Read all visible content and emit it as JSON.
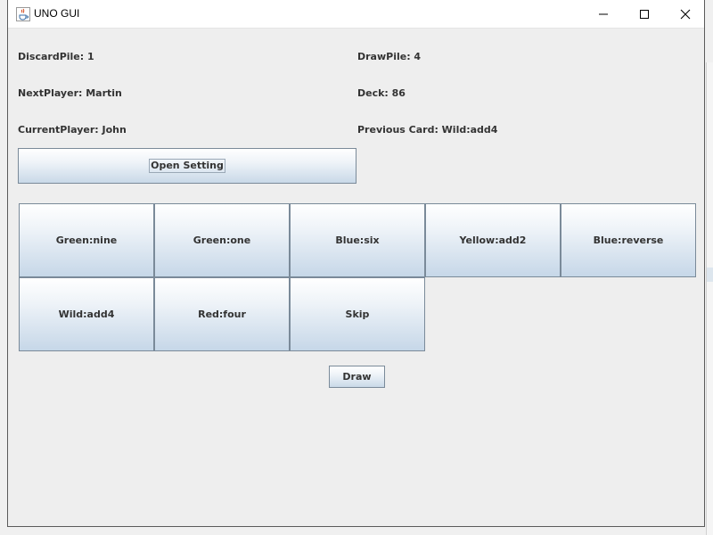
{
  "window": {
    "title": "UNO GUI",
    "icon": "java-cup-icon"
  },
  "info": {
    "discard_pile": "DiscardPile: 1",
    "draw_pile": "DrawPile: 4",
    "next_player": "NextPlayer: Martin",
    "deck": "Deck: 86",
    "current_player": "CurrentPlayer: John",
    "previous_card": "Previous Card: Wild:add4"
  },
  "controls": {
    "open_setting_label": "Open Setting",
    "draw_label": "Draw"
  },
  "hand": {
    "cards": [
      "Green:nine",
      "Green:one",
      "Blue:six",
      "Yellow:add2",
      "Blue:reverse",
      "Wild:add4",
      "Red:four",
      "Skip"
    ]
  }
}
